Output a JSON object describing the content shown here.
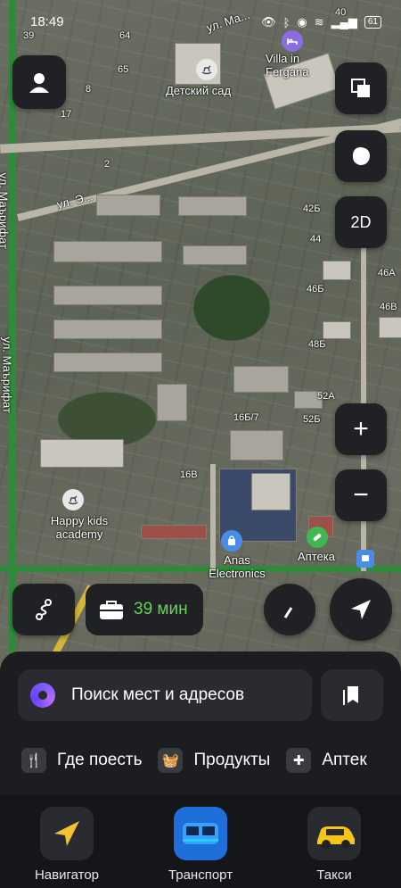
{
  "status": {
    "time": "18:49",
    "battery": "61"
  },
  "map": {
    "labels": {
      "kindergarten": "Детский сад",
      "villa": "Villa in Fergana",
      "happy_kids": "Happy kids academy",
      "anas": "Anas Electronics",
      "apteka": "Аптека",
      "street_marifat_1": "ул. Маърифат",
      "street_marifat_2": "ул. Маърифат",
      "street_top": "ул. Ма...",
      "street_mid": "ул. Э...",
      "house_65": "65",
      "house_46b": "46Б",
      "house_46a": "46А",
      "house_46v": "46В",
      "house_48b": "48Б",
      "house_52a": "52А",
      "house_52b": "52Б",
      "house_16b7": "16Б/7",
      "house_16v": "16В",
      "house_39": "39",
      "house_64": "64",
      "house_17": "17",
      "house_8": "8",
      "house_2": "2",
      "house_40": "40",
      "house_42b": "42Б",
      "house_44": "44"
    }
  },
  "controls": {
    "layers_icon": "layers-icon",
    "mode_label": "2D",
    "zoom_in": "+",
    "zoom_out": "−"
  },
  "travel": {
    "minutes": "39 мин"
  },
  "panel": {
    "search_placeholder": "Поиск мест и адресов",
    "chips": [
      {
        "label": "Где поесть",
        "icon": "fork-knife-icon"
      },
      {
        "label": "Продукты",
        "icon": "basket-icon"
      },
      {
        "label": "Аптек",
        "icon": "plus-icon"
      }
    ]
  },
  "tabs": [
    {
      "label": "Навигатор",
      "icon": "navigator-icon"
    },
    {
      "label": "Транспорт",
      "icon": "bus-icon"
    },
    {
      "label": "Такси",
      "icon": "taxi-icon"
    }
  ],
  "colors": {
    "accent_green": "#6cd05a",
    "road_green": "#2e8b3a",
    "panel_bg": "#1c1d21"
  }
}
